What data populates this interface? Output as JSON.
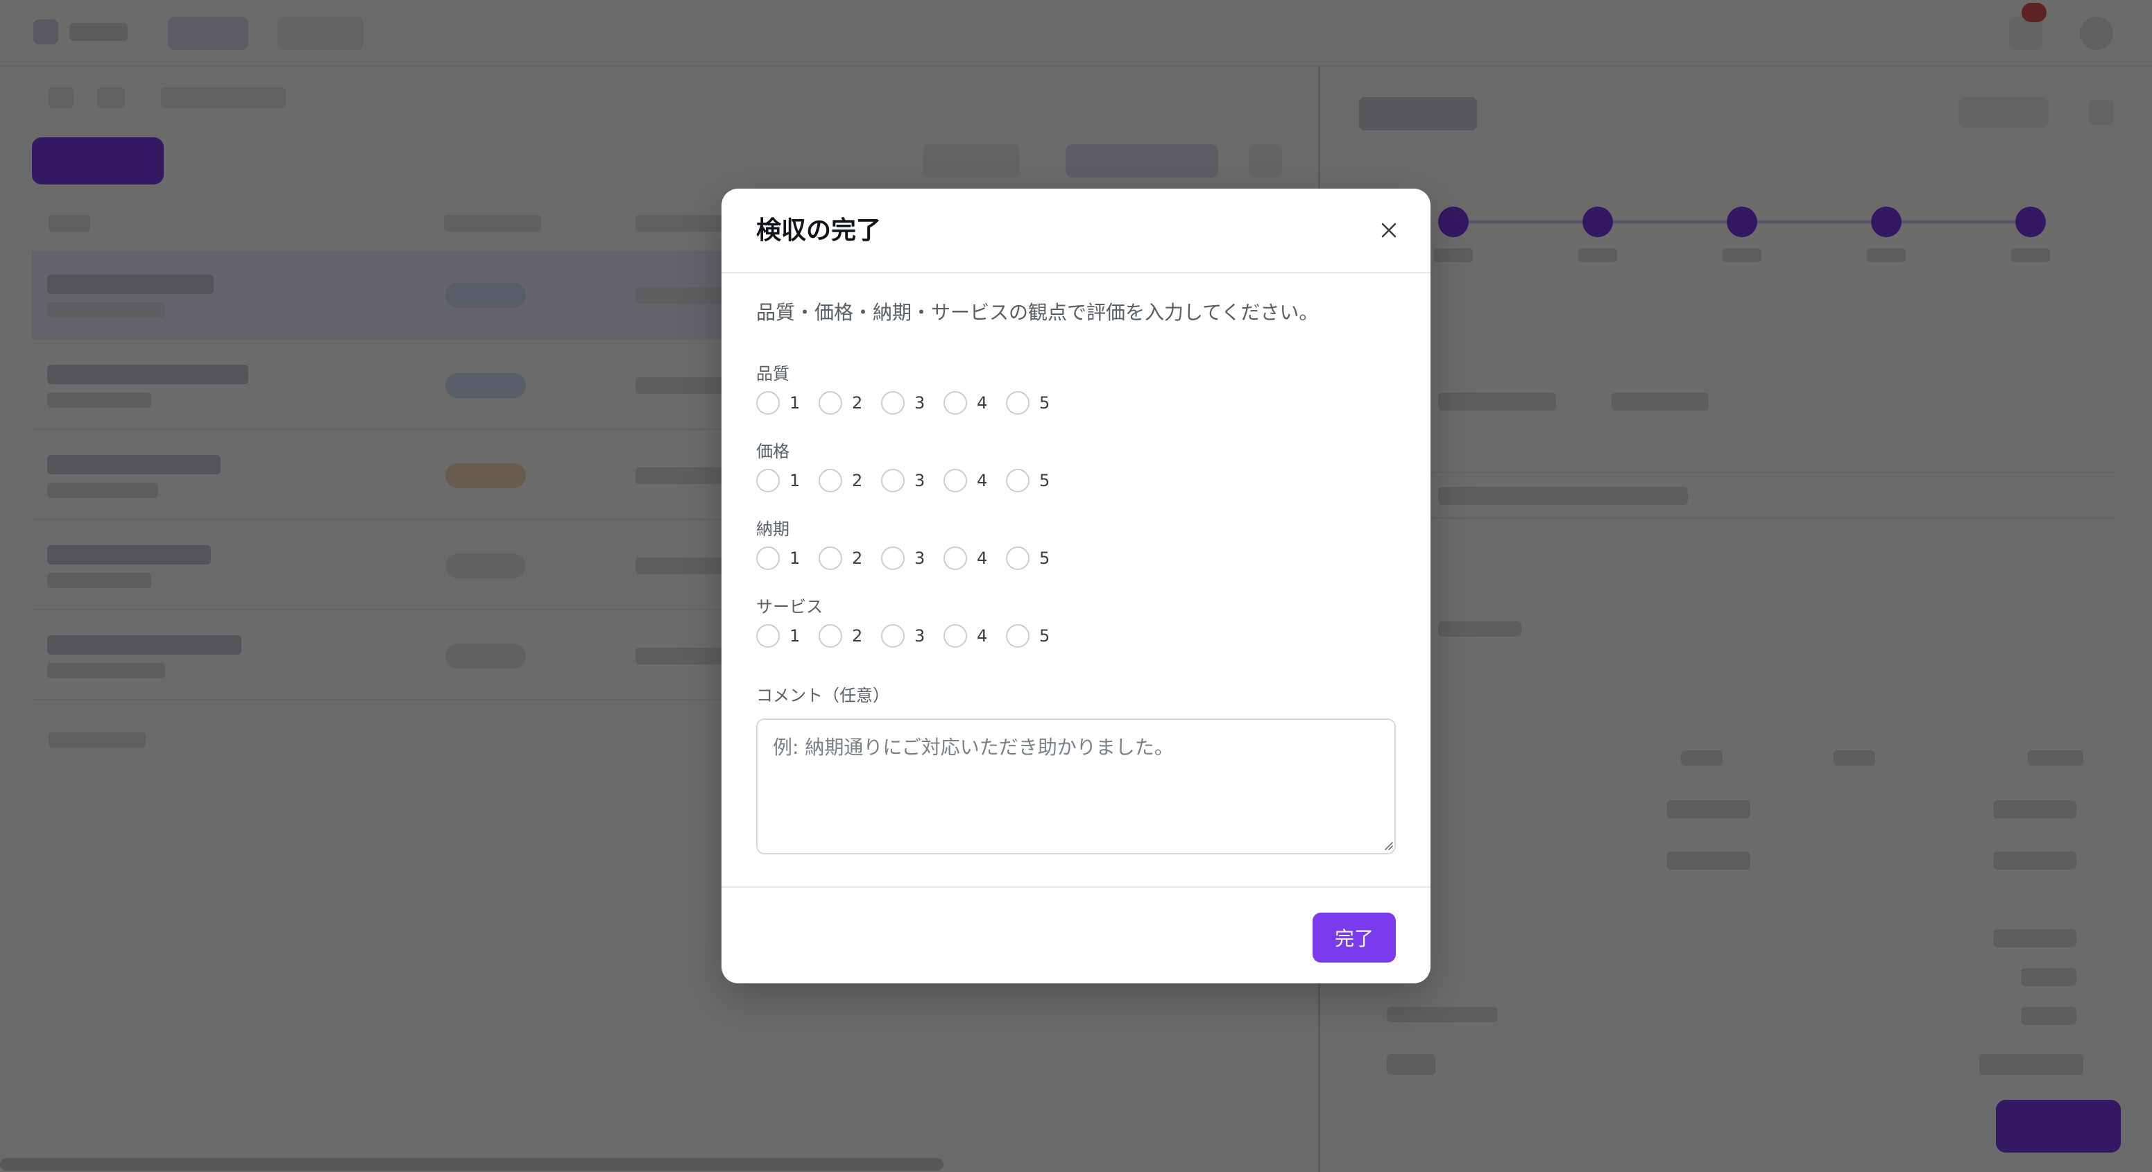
{
  "modal": {
    "title": "検収の完了",
    "close_icon": "close-icon",
    "instruction": "品質・価格・納期・サービスの観点で評価を入力してください。",
    "rating_groups": [
      {
        "label": "品質",
        "options": [
          "1",
          "2",
          "3",
          "4",
          "5"
        ],
        "selected": null
      },
      {
        "label": "価格",
        "options": [
          "1",
          "2",
          "3",
          "4",
          "5"
        ],
        "selected": null
      },
      {
        "label": "納期",
        "options": [
          "1",
          "2",
          "3",
          "4",
          "5"
        ],
        "selected": null
      },
      {
        "label": "サービス",
        "options": [
          "1",
          "2",
          "3",
          "4",
          "5"
        ],
        "selected": null
      }
    ],
    "comment": {
      "label": "コメント（任意）",
      "placeholder": "例: 納期通りにご対応いただき助かりました。",
      "value": ""
    },
    "submit_label": "完了"
  },
  "colors": {
    "accent": "#7c3aed",
    "overlay": "rgba(0,0,0,0.58)",
    "badge_blue": "#cfe0f6",
    "badge_orange": "#f6dcb8",
    "badge_gray": "#e4e6ea",
    "notification": "#d9534f"
  }
}
